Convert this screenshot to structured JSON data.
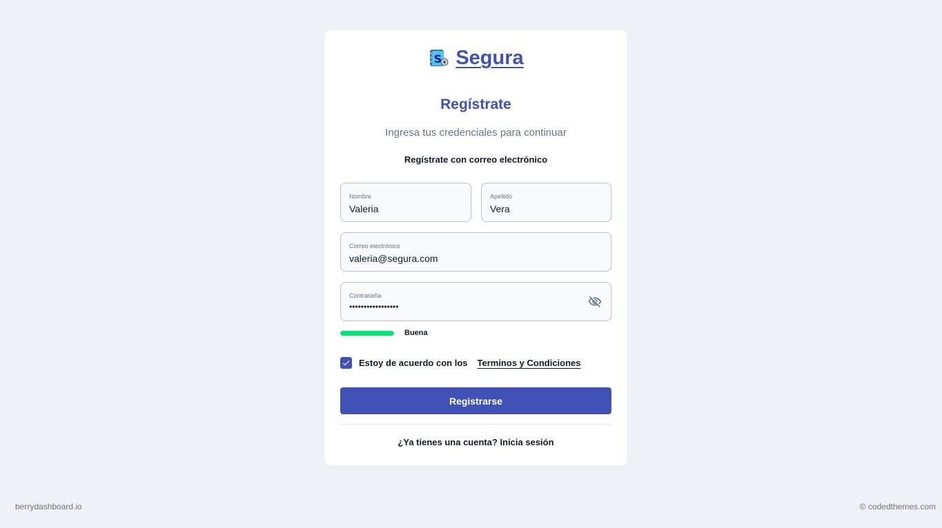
{
  "brand": {
    "name": "Segura",
    "icon": "s-logo-icon"
  },
  "header": {
    "title": "Regístrate",
    "subtitle": "Ingresa tus credenciales para continuar",
    "signup_method": "Regístrate con correo electrónico"
  },
  "form": {
    "first_name": {
      "label": "Nombre",
      "value": "Valeria"
    },
    "last_name": {
      "label": "Apellido",
      "value": "Vera"
    },
    "email": {
      "label": "Correo electrónico",
      "value": "valeria@segura.com"
    },
    "password": {
      "label": "Contraseña",
      "value": "•••••••••••••••••",
      "toggle_icon": "eye-off-icon"
    },
    "strength": {
      "label": "Buena",
      "level": 1.0,
      "color": "#00e676"
    },
    "agree": {
      "checked": true,
      "text": "Estoy de acuerdo con los",
      "link": "Terminos y Condiciones"
    },
    "submit_label": "Registrarse"
  },
  "login_prompt": "¿Ya tienes una cuenta? Inicia sesión",
  "footer": {
    "left": "berrydashboard.io",
    "right": "© codedthemes.com"
  },
  "colors": {
    "primary": "#3f51b5",
    "background": "#eef2f6",
    "success": "#00e676"
  }
}
